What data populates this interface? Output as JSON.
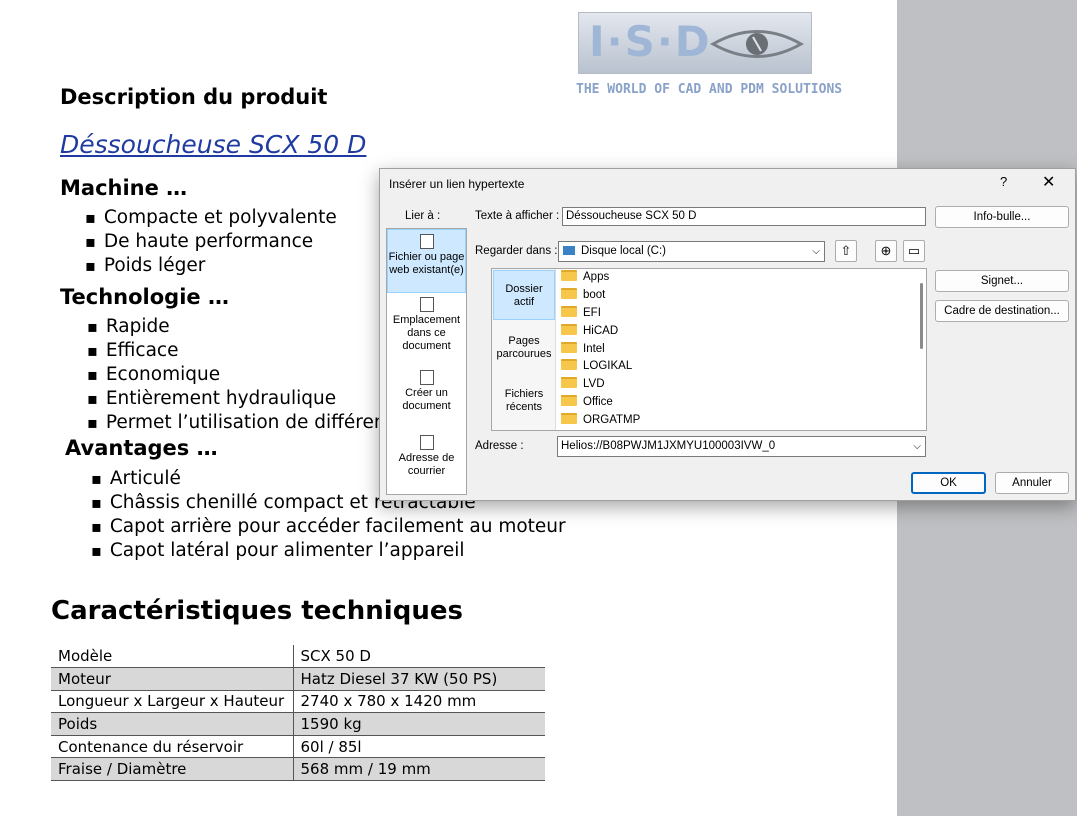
{
  "logo": {
    "letters": "I·S·D",
    "tagline": "THE WORLD OF CAD AND PDM SOLUTIONS"
  },
  "document": {
    "description_heading": "Description du produit",
    "product_link": "Déssoucheuse SCX 50 D",
    "sections": [
      {
        "heading": "Machine …",
        "items": [
          "Compacte et polyvalente",
          "De haute performance",
          "Poids léger"
        ]
      },
      {
        "heading": "Technologie …",
        "items": [
          "Rapide",
          "Efficace",
          "Economique",
          "Entièrement hydraulique",
          "Permet l’utilisation de différen"
        ]
      },
      {
        "heading": "Avantages …",
        "items": [
          "Articulé",
          "Châssis chenillé compact et rétractable",
          "Capot arrière pour accéder facilement au moteur",
          "Capot latéral pour alimenter l’appareil"
        ]
      }
    ],
    "tech_heading": "Caractéristiques techniques",
    "spec_table": [
      [
        "Modèle",
        "SCX 50 D"
      ],
      [
        "Moteur",
        "Hatz Diesel 37 KW (50 PS)"
      ],
      [
        "Longueur x Largeur x Hauteur",
        "2740 x 780 x 1420 mm"
      ],
      [
        "Poids",
        "1590 kg"
      ],
      [
        "Contenance du réservoir",
        "60l / 85l"
      ],
      [
        "Fraise / Diamètre",
        "568 mm / 19 mm"
      ]
    ]
  },
  "dialog": {
    "title": "Insérer un lien hypertexte",
    "help": "?",
    "close": "✕",
    "link_to_label": "Lier à :",
    "link_options": [
      {
        "label": "Fichier ou page web existant(e)",
        "icon": "web-file-icon"
      },
      {
        "label": "Emplacement dans ce document",
        "icon": "document-place-icon"
      },
      {
        "label": "Créer un document",
        "icon": "new-document-icon"
      },
      {
        "label": "Adresse de courrier",
        "icon": "email-icon"
      }
    ],
    "text_to_display_label": "Texte à afficher :",
    "text_to_display_value": "Déssoucheuse SCX 50 D",
    "screentip_button": "Info-bulle...",
    "look_in_label": "Regarder dans :",
    "look_in_value": "Disque local (C:)",
    "look_tabs": [
      "Dossier actif",
      "Pages parcourues",
      "Fichiers récents"
    ],
    "folders": [
      "Apps",
      "boot",
      "EFI",
      "HiCAD",
      "Intel",
      "LOGIKAL",
      "LVD",
      "Office",
      "ORGATMP"
    ],
    "bookmark_button": "Signet...",
    "target_frame_button": "Cadre de destination...",
    "address_label": "Adresse :",
    "address_value": "Helios://B08PWJM1JXMYU100003IVW_0",
    "ok_button": "OK",
    "cancel_button": "Annuler"
  }
}
